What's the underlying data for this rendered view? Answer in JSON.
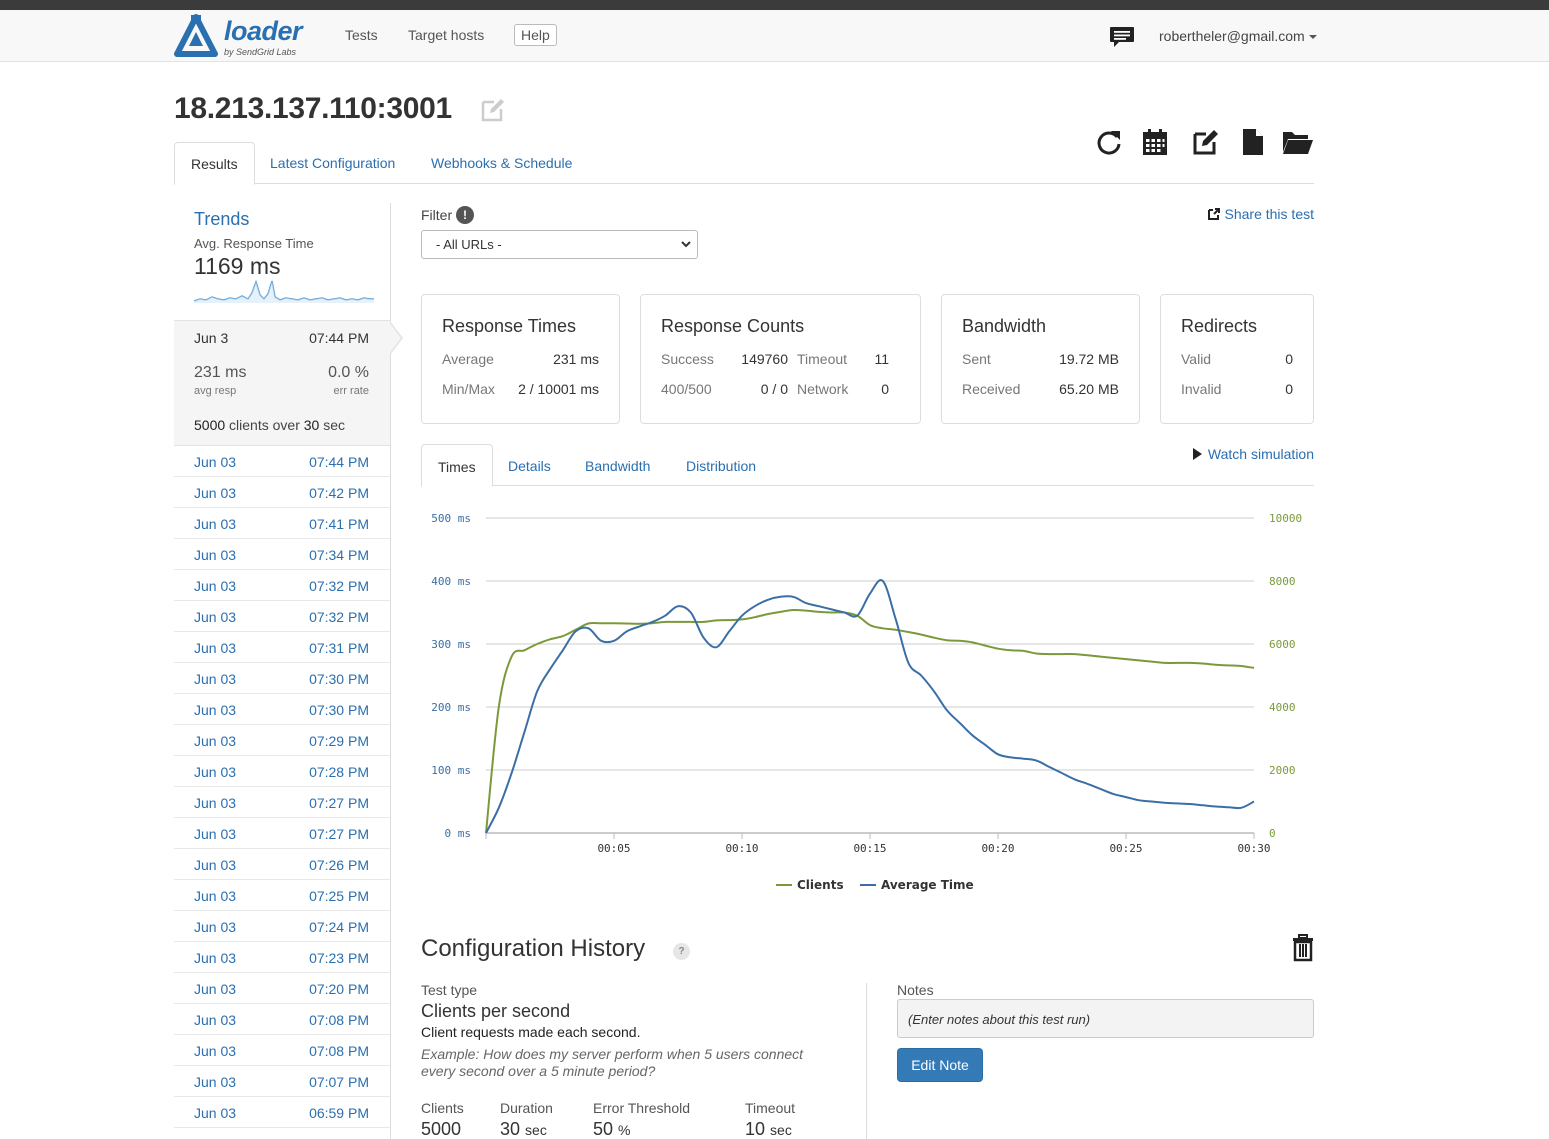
{
  "brand": {
    "name": "loader",
    "tagline": "by SendGrid Labs",
    "color": "#2a6fb0"
  },
  "nav": {
    "tests": "Tests",
    "target_hosts": "Target hosts",
    "help": "Help",
    "user_email": "robertheler@gmail.com"
  },
  "page": {
    "title": "18.213.137.110:3001"
  },
  "tabs": {
    "results": "Results",
    "latest_config": "Latest Configuration",
    "webhooks": "Webhooks & Schedule"
  },
  "toolbar": {
    "icons": [
      "refresh-icon",
      "calendar-icon",
      "edit-icon",
      "document-icon",
      "folder-open-icon"
    ]
  },
  "sidebar": {
    "trends_title": "Trends",
    "trends_sub": "Avg. Response Time",
    "trends_value": "1169 ms",
    "selected": {
      "date": "Jun 3",
      "time": "07:44 PM",
      "avg_resp": "231 ms",
      "avg_resp_label": "avg resp",
      "err_rate": "0.0 %",
      "err_rate_label": "err rate",
      "clients": "5000",
      "clients_mid": "clients over",
      "duration": "30",
      "duration_unit": "sec"
    },
    "runs": [
      {
        "date": "Jun 03",
        "time": "07:44 PM"
      },
      {
        "date": "Jun 03",
        "time": "07:42 PM"
      },
      {
        "date": "Jun 03",
        "time": "07:41 PM"
      },
      {
        "date": "Jun 03",
        "time": "07:34 PM"
      },
      {
        "date": "Jun 03",
        "time": "07:32 PM"
      },
      {
        "date": "Jun 03",
        "time": "07:32 PM"
      },
      {
        "date": "Jun 03",
        "time": "07:31 PM"
      },
      {
        "date": "Jun 03",
        "time": "07:30 PM"
      },
      {
        "date": "Jun 03",
        "time": "07:30 PM"
      },
      {
        "date": "Jun 03",
        "time": "07:29 PM"
      },
      {
        "date": "Jun 03",
        "time": "07:28 PM"
      },
      {
        "date": "Jun 03",
        "time": "07:27 PM"
      },
      {
        "date": "Jun 03",
        "time": "07:27 PM"
      },
      {
        "date": "Jun 03",
        "time": "07:26 PM"
      },
      {
        "date": "Jun 03",
        "time": "07:25 PM"
      },
      {
        "date": "Jun 03",
        "time": "07:24 PM"
      },
      {
        "date": "Jun 03",
        "time": "07:23 PM"
      },
      {
        "date": "Jun 03",
        "time": "07:20 PM"
      },
      {
        "date": "Jun 03",
        "time": "07:08 PM"
      },
      {
        "date": "Jun 03",
        "time": "07:08 PM"
      },
      {
        "date": "Jun 03",
        "time": "07:07 PM"
      },
      {
        "date": "Jun 03",
        "time": "06:59 PM"
      }
    ]
  },
  "filter": {
    "label": "Filter",
    "selected": "- All URLs -"
  },
  "share": "Share this test",
  "cards": {
    "response_times": {
      "title": "Response Times",
      "average_label": "Average",
      "average": "231 ms",
      "minmax_label": "Min/Max",
      "minmax": "2 / 10001 ms"
    },
    "response_counts": {
      "title": "Response Counts",
      "success_label": "Success",
      "success": "149760",
      "timeout_label": "Timeout",
      "timeout": "11",
      "e400_label": "400/500",
      "e400": "0 / 0",
      "network_label": "Network",
      "network": "0"
    },
    "bandwidth": {
      "title": "Bandwidth",
      "sent_label": "Sent",
      "sent": "19.72 MB",
      "received_label": "Received",
      "received": "65.20 MB"
    },
    "redirects": {
      "title": "Redirects",
      "valid_label": "Valid",
      "valid": "0",
      "invalid_label": "Invalid",
      "invalid": "0"
    }
  },
  "subtabs": {
    "times": "Times",
    "details": "Details",
    "bandwidth": "Bandwidth",
    "distribution": "Distribution"
  },
  "watch": "Watch simulation",
  "chart_data": {
    "type": "line",
    "x": [
      0,
      0.5,
      1,
      1.5,
      2,
      2.5,
      3,
      3.5,
      4,
      4.5,
      5,
      5.5,
      6,
      6.5,
      7,
      7.5,
      8,
      8.5,
      9,
      9.5,
      10,
      10.5,
      11,
      11.5,
      12,
      12.5,
      13,
      13.5,
      14,
      14.5,
      15,
      15.5,
      16,
      16.5,
      17,
      17.5,
      18,
      18.5,
      19,
      19.5,
      20,
      20.5,
      21,
      21.5,
      22,
      22.5,
      23,
      23.5,
      24,
      24.5,
      25,
      25.5,
      26,
      26.5,
      27,
      27.5,
      28,
      28.5,
      29,
      29.5,
      30
    ],
    "x_ticks": [
      "00:05",
      "00:10",
      "00:15",
      "00:20",
      "00:25",
      "00:30"
    ],
    "y_left_ticks": [
      "0 ms",
      "100 ms",
      "200 ms",
      "300 ms",
      "400 ms",
      "500 ms"
    ],
    "y_right_ticks": [
      "0",
      "2000",
      "4000",
      "6000",
      "8000",
      "10000"
    ],
    "ylim_left": [
      0,
      500
    ],
    "ylim_right": [
      0,
      10000
    ],
    "series": [
      {
        "name": "Clients",
        "axis": "right",
        "color": "#7a9a3a",
        "values": [
          0,
          4000,
          5600,
          5800,
          6000,
          6150,
          6250,
          6450,
          6650,
          6660,
          6660,
          6650,
          6640,
          6660,
          6700,
          6700,
          6700,
          6700,
          6750,
          6760,
          6780,
          6850,
          6950,
          7020,
          7080,
          7060,
          7020,
          7000,
          7000,
          6900,
          6600,
          6500,
          6450,
          6380,
          6300,
          6200,
          6120,
          6100,
          6050,
          5950,
          5850,
          5800,
          5780,
          5700,
          5680,
          5680,
          5680,
          5640,
          5600,
          5560,
          5520,
          5480,
          5440,
          5400,
          5400,
          5400,
          5380,
          5340,
          5320,
          5300,
          5240
        ]
      },
      {
        "name": "Average Time",
        "axis": "left",
        "color": "#3b6ea5",
        "values": [
          0,
          40,
          95,
          160,
          225,
          260,
          290,
          320,
          325,
          305,
          305,
          320,
          328,
          335,
          345,
          360,
          350,
          310,
          295,
          320,
          345,
          360,
          370,
          375,
          375,
          365,
          360,
          355,
          350,
          345,
          380,
          400,
          340,
          270,
          250,
          225,
          195,
          175,
          155,
          140,
          125,
          120,
          118,
          115,
          105,
          95,
          85,
          78,
          70,
          62,
          57,
          52,
          50,
          48,
          47,
          46,
          44,
          42,
          41,
          40,
          50
        ]
      }
    ]
  },
  "config": {
    "title": "Configuration History",
    "help": "?",
    "test_type_label": "Test type",
    "test_type": "Clients per second",
    "test_type_desc": "Client requests made each second.",
    "test_type_example": "Example: How does my server perform when 5 users connect every second over a 5 minute period?",
    "clients_label": "Clients",
    "clients": "5000",
    "duration_label": "Duration",
    "duration": "30",
    "duration_unit": "sec",
    "error_threshold_label": "Error Threshold",
    "error_threshold": "50",
    "error_threshold_unit": "%",
    "timeout_label": "Timeout",
    "timeout": "10",
    "timeout_unit": "sec",
    "notes_label": "Notes",
    "notes_placeholder": "(Enter notes about this test run)",
    "edit_note": "Edit Note"
  }
}
